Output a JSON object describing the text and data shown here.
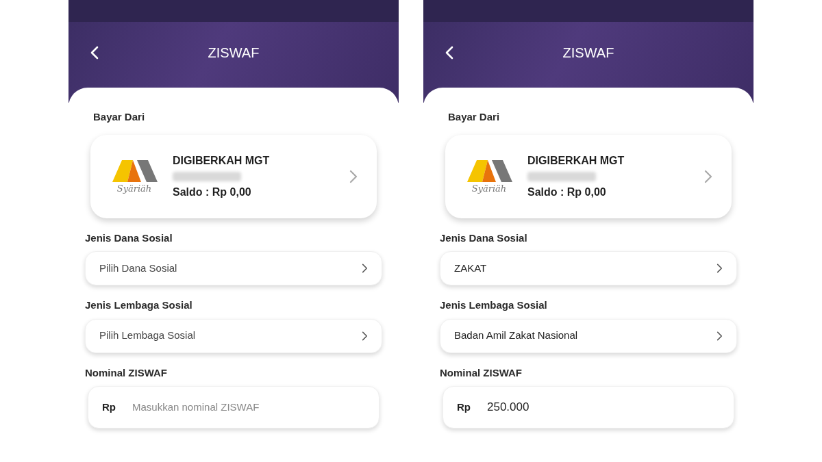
{
  "screens": [
    {
      "title": "ZISWAF",
      "pay_from": {
        "label": "Bayar Dari",
        "account_name": "DIGIBERKAH MGT",
        "balance": "Saldo : Rp 0,00",
        "logo_text": "Syäriäh"
      },
      "fund_type": {
        "label": "Jenis Dana Sosial",
        "placeholder": "Pilih Dana Sosial"
      },
      "institution": {
        "label": "Jenis Lembaga Sosial",
        "placeholder": "Pilih Lembaga Sosial"
      },
      "amount": {
        "label": "Nominal ZISWAF",
        "currency": "Rp",
        "placeholder": "Masukkan nominal ZISWAF"
      }
    },
    {
      "title": "ZISWAF",
      "pay_from": {
        "label": "Bayar Dari",
        "account_name": "DIGIBERKAH MGT",
        "balance": "Saldo : Rp 0,00",
        "logo_text": "Syäriäh"
      },
      "fund_type": {
        "label": "Jenis Dana Sosial",
        "value": "ZAKAT"
      },
      "institution": {
        "label": "Jenis Lembaga Sosial",
        "value": "Badan Amil Zakat Nasional"
      },
      "amount": {
        "label": "Nominal ZISWAF",
        "currency": "Rp",
        "value": "250.000"
      }
    }
  ]
}
